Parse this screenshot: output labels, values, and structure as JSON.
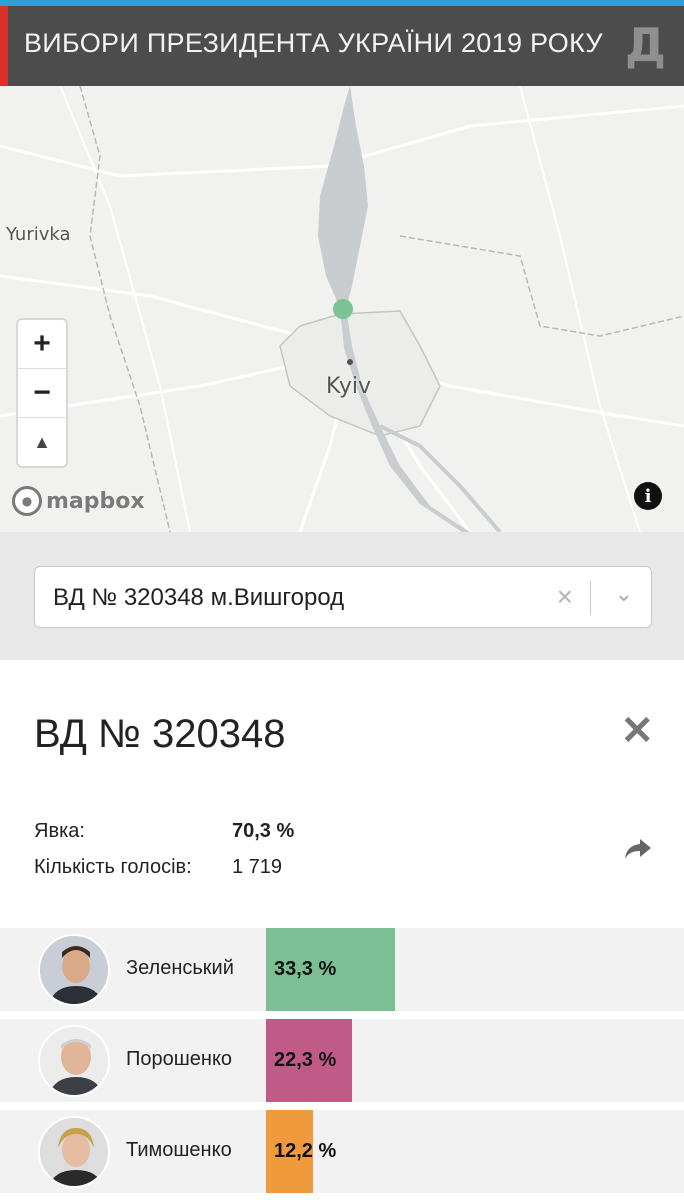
{
  "header": {
    "title": "ВИБОРИ ПРЕЗИДЕНТА УКРАЇНИ 2019 РОКУ",
    "logo": "Д"
  },
  "map": {
    "labels": {
      "kyiv": "Kyiv",
      "yurivka": "Yurivka"
    },
    "zoom_in": "+",
    "zoom_out": "−",
    "compass": "▲",
    "attribution_logo": "mapbox",
    "info": "i",
    "marker_color": "#7cc495"
  },
  "select": {
    "value": "ВД № 320348 м.Вишгород",
    "clear": "×",
    "chevron": "⌄"
  },
  "detail": {
    "title": "ВД № 320348",
    "close": "✕",
    "turnout_label": "Явка:",
    "turnout_value": "70,3 %",
    "votes_label": "Кількість голосів:",
    "votes_value": "1 719",
    "share_icon": "share-icon"
  },
  "candidates": [
    {
      "name": "Зеленський",
      "percent_label": "33,3 %",
      "percent": 33.3,
      "color": "#7cbf94"
    },
    {
      "name": "Порошенко",
      "percent_label": "22,3 %",
      "percent": 22.3,
      "color": "#c05a87"
    },
    {
      "name": "Тимошенко",
      "percent_label": "12,2 %",
      "percent": 12.2,
      "color": "#ef9a3d"
    }
  ]
}
